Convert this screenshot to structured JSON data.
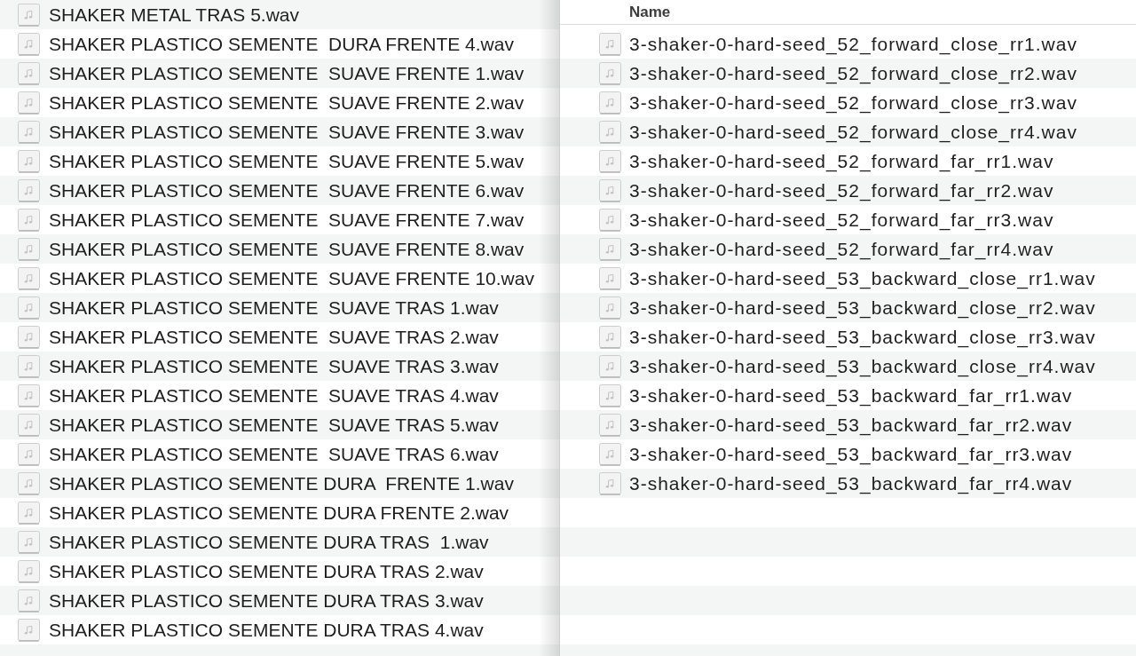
{
  "left_window": {
    "files": [
      "SHAKER METAL TRAS 5.wav",
      "SHAKER PLASTICO SEMENTE  DURA FRENTE 4.wav",
      "SHAKER PLASTICO SEMENTE  SUAVE FRENTE 1.wav",
      "SHAKER PLASTICO SEMENTE  SUAVE FRENTE 2.wav",
      "SHAKER PLASTICO SEMENTE  SUAVE FRENTE 3.wav",
      "SHAKER PLASTICO SEMENTE  SUAVE FRENTE 5.wav",
      "SHAKER PLASTICO SEMENTE  SUAVE FRENTE 6.wav",
      "SHAKER PLASTICO SEMENTE  SUAVE FRENTE 7.wav",
      "SHAKER PLASTICO SEMENTE  SUAVE FRENTE 8.wav",
      "SHAKER PLASTICO SEMENTE  SUAVE FRENTE 10.wav",
      "SHAKER PLASTICO SEMENTE  SUAVE TRAS 1.wav",
      "SHAKER PLASTICO SEMENTE  SUAVE TRAS 2.wav",
      "SHAKER PLASTICO SEMENTE  SUAVE TRAS 3.wav",
      "SHAKER PLASTICO SEMENTE  SUAVE TRAS 4.wav",
      "SHAKER PLASTICO SEMENTE  SUAVE TRAS 5.wav",
      "SHAKER PLASTICO SEMENTE  SUAVE TRAS 6.wav",
      "SHAKER PLASTICO SEMENTE DURA  FRENTE 1.wav",
      "SHAKER PLASTICO SEMENTE DURA FRENTE 2.wav",
      "SHAKER PLASTICO SEMENTE DURA TRAS  1.wav",
      "SHAKER PLASTICO SEMENTE DURA TRAS 2.wav",
      "SHAKER PLASTICO SEMENTE DURA TRAS 3.wav",
      "SHAKER PLASTICO SEMENTE DURA TRAS 4.wav"
    ]
  },
  "right_window": {
    "column_header": "Name",
    "files": [
      "3-shaker-0-hard-seed_52_forward_close_rr1.wav",
      "3-shaker-0-hard-seed_52_forward_close_rr2.wav",
      "3-shaker-0-hard-seed_52_forward_close_rr3.wav",
      "3-shaker-0-hard-seed_52_forward_close_rr4.wav",
      "3-shaker-0-hard-seed_52_forward_far_rr1.wav",
      "3-shaker-0-hard-seed_52_forward_far_rr2.wav",
      "3-shaker-0-hard-seed_52_forward_far_rr3.wav",
      "3-shaker-0-hard-seed_52_forward_far_rr4.wav",
      "3-shaker-0-hard-seed_53_backward_close_rr1.wav",
      "3-shaker-0-hard-seed_53_backward_close_rr2.wav",
      "3-shaker-0-hard-seed_53_backward_close_rr3.wav",
      "3-shaker-0-hard-seed_53_backward_close_rr4.wav",
      "3-shaker-0-hard-seed_53_backward_far_rr1.wav",
      "3-shaker-0-hard-seed_53_backward_far_rr2.wav",
      "3-shaker-0-hard-seed_53_backward_far_rr3.wav",
      "3-shaker-0-hard-seed_53_backward_far_rr4.wav"
    ]
  }
}
